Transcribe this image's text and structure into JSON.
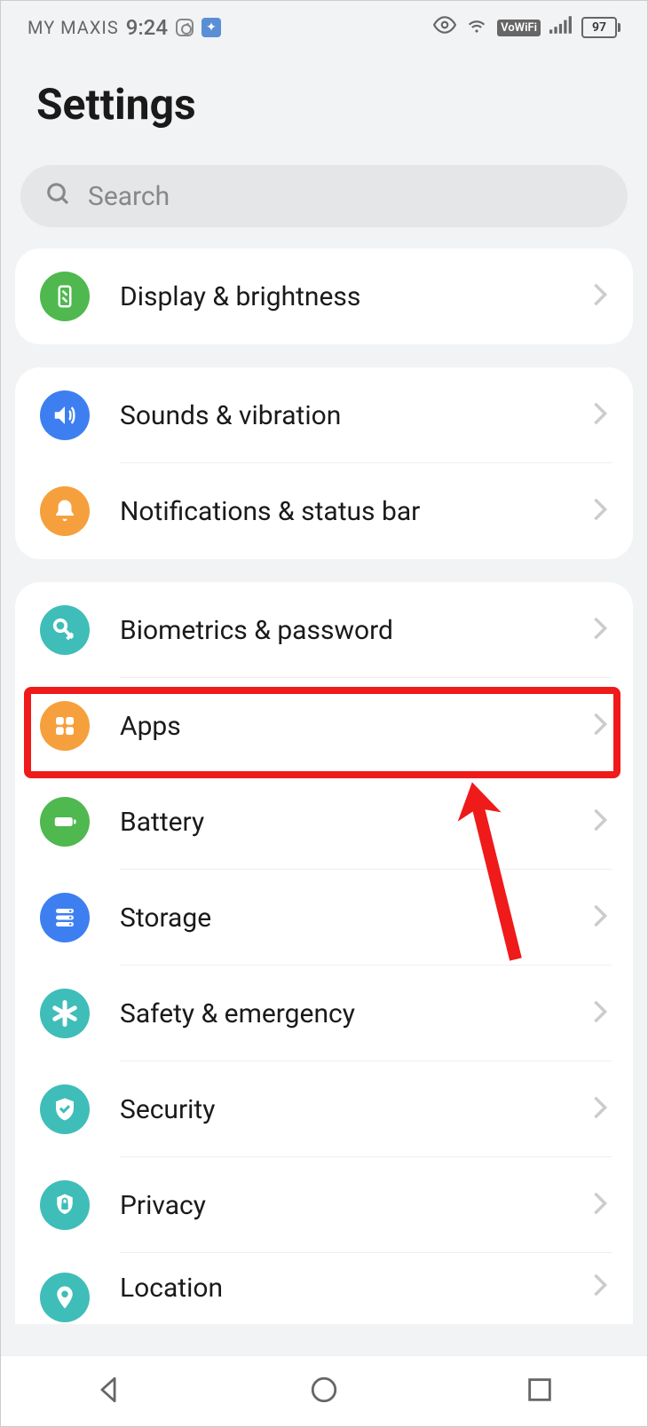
{
  "status": {
    "carrier": "MY MAXIS",
    "time": "9:24",
    "vowifi": "VoWiFi",
    "battery": "97"
  },
  "title": "Settings",
  "search": {
    "placeholder": "Search"
  },
  "groups": [
    {
      "rows": [
        {
          "id": "display",
          "label": "Display & brightness",
          "icon": "display",
          "color": "c-green"
        }
      ]
    },
    {
      "rows": [
        {
          "id": "sounds",
          "label": "Sounds & vibration",
          "icon": "speaker",
          "color": "c-blue"
        },
        {
          "id": "notifications",
          "label": "Notifications & status bar",
          "icon": "bell",
          "color": "c-orange"
        }
      ]
    },
    {
      "rows": [
        {
          "id": "biometrics",
          "label": "Biometrics & password",
          "icon": "key",
          "color": "c-teal"
        },
        {
          "id": "apps",
          "label": "Apps",
          "icon": "grid",
          "color": "c-orange",
          "highlighted": true
        },
        {
          "id": "battery",
          "label": "Battery",
          "icon": "batt",
          "color": "c-green"
        },
        {
          "id": "storage",
          "label": "Storage",
          "icon": "stack",
          "color": "c-blue"
        },
        {
          "id": "safety",
          "label": "Safety & emergency",
          "icon": "asterisk",
          "color": "c-teal"
        },
        {
          "id": "security",
          "label": "Security",
          "icon": "shield",
          "color": "c-teal"
        },
        {
          "id": "privacy",
          "label": "Privacy",
          "icon": "lock",
          "color": "c-teal"
        },
        {
          "id": "location",
          "label": "Location",
          "icon": "pin",
          "color": "c-teal"
        }
      ]
    }
  ]
}
